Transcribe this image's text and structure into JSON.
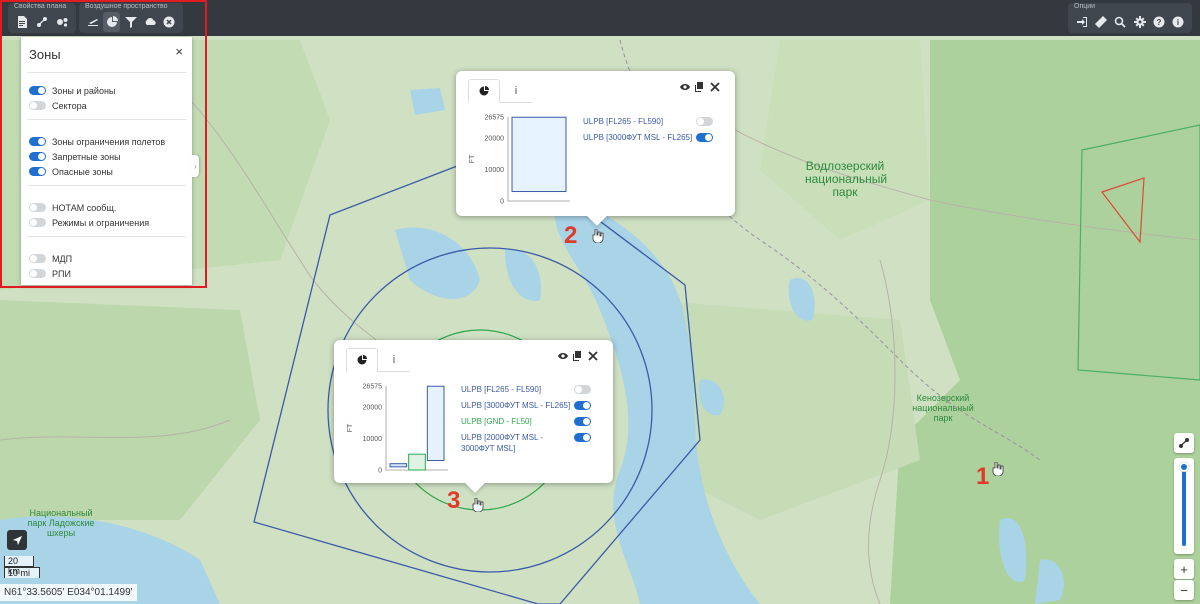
{
  "topbar": {
    "group_plan_title": "Свойства плана",
    "group_airspace_title": "Воздушное пространство",
    "group_options_title": "Опции",
    "plan_icons": [
      "document-icon",
      "route-icon",
      "settings-cogs-icon"
    ],
    "airspace_icons": [
      "plane-icon",
      "pie-chart-icon",
      "filter-icon",
      "cloud-icon",
      "close-circle-icon"
    ],
    "options_icons": [
      "login-icon",
      "ruler-icon",
      "search-icon",
      "gear-icon",
      "help-icon",
      "info-icon"
    ]
  },
  "zones_panel": {
    "title": "Зоны",
    "close": "×",
    "groups": [
      [
        {
          "label": "Зоны и районы",
          "on": true
        },
        {
          "label": "Сектора",
          "on": false
        }
      ],
      [
        {
          "label": "Зоны ограничения полетов",
          "on": true
        },
        {
          "label": "Запретные зоны",
          "on": true
        },
        {
          "label": "Опасные зоны",
          "on": true
        }
      ],
      [
        {
          "label": "НОТАМ сообщ.",
          "on": false
        },
        {
          "label": "Режимы и ограничения",
          "on": false
        }
      ],
      [
        {
          "label": "МДП",
          "on": false
        },
        {
          "label": "РПИ",
          "on": false
        }
      ]
    ]
  },
  "popup_top": {
    "tab_info": "i",
    "chart_data": {
      "type": "bar",
      "ylabel": "FT",
      "yticks": [
        0,
        10000,
        20000,
        26575
      ],
      "ylim": [
        0,
        26575
      ],
      "bars": [
        {
          "from": 3000,
          "to": 26500,
          "color": "#3b5ba8",
          "fill": "#e6f3fc"
        }
      ]
    },
    "layers": [
      {
        "name": "ULPB [FL265 - FL590]",
        "color": "#3b5ba8",
        "on": false
      },
      {
        "name": "ULPB [3000ФУТ MSL - FL265]",
        "color": "#3b5ba8",
        "on": true
      }
    ]
  },
  "popup_bottom": {
    "tab_info": "i",
    "chart_data": {
      "type": "bar",
      "ylabel": "FT",
      "yticks": [
        0,
        10000,
        20000,
        26575
      ],
      "ylim": [
        0,
        26575
      ],
      "bars": [
        {
          "from": 1000,
          "to": 2000,
          "color": "#3b5ba8",
          "fill": "#dbe6f5"
        },
        {
          "from": 0,
          "to": 5000,
          "color": "#2ea84e",
          "fill": "#dff3e4"
        },
        {
          "from": 3000,
          "to": 26500,
          "color": "#3b5ba8",
          "fill": "#e6f3fc"
        }
      ]
    },
    "layers": [
      {
        "name": "ULPB [FL265 - FL590]",
        "color": "#3b5ba8",
        "on": false
      },
      {
        "name": "ULPB [3000ФУТ MSL - FL265]",
        "color": "#3b5ba8",
        "on": true
      },
      {
        "name": "ULPB [GND - FL50]",
        "color": "#2ea84e",
        "on": true
      },
      {
        "name": "ULPB [2000ФУТ MSL - 3000ФУТ MSL]",
        "color": "#3b5ba8",
        "on": true
      }
    ]
  },
  "annotations": [
    "1",
    "2",
    "3"
  ],
  "map_labels": {
    "vodlozersky": "Водлозерский национальный парк",
    "kenozersky": "Кенозерский национальный парк",
    "ladoga": "Национальный парк Ладожские шхеры"
  },
  "scale": {
    "km": "20 km",
    "mi": "10 mi"
  },
  "coords": "N61°33.5605' E034°01.1499'",
  "zoom": {
    "plus": "+",
    "minus": "−",
    "level": 0.95
  }
}
